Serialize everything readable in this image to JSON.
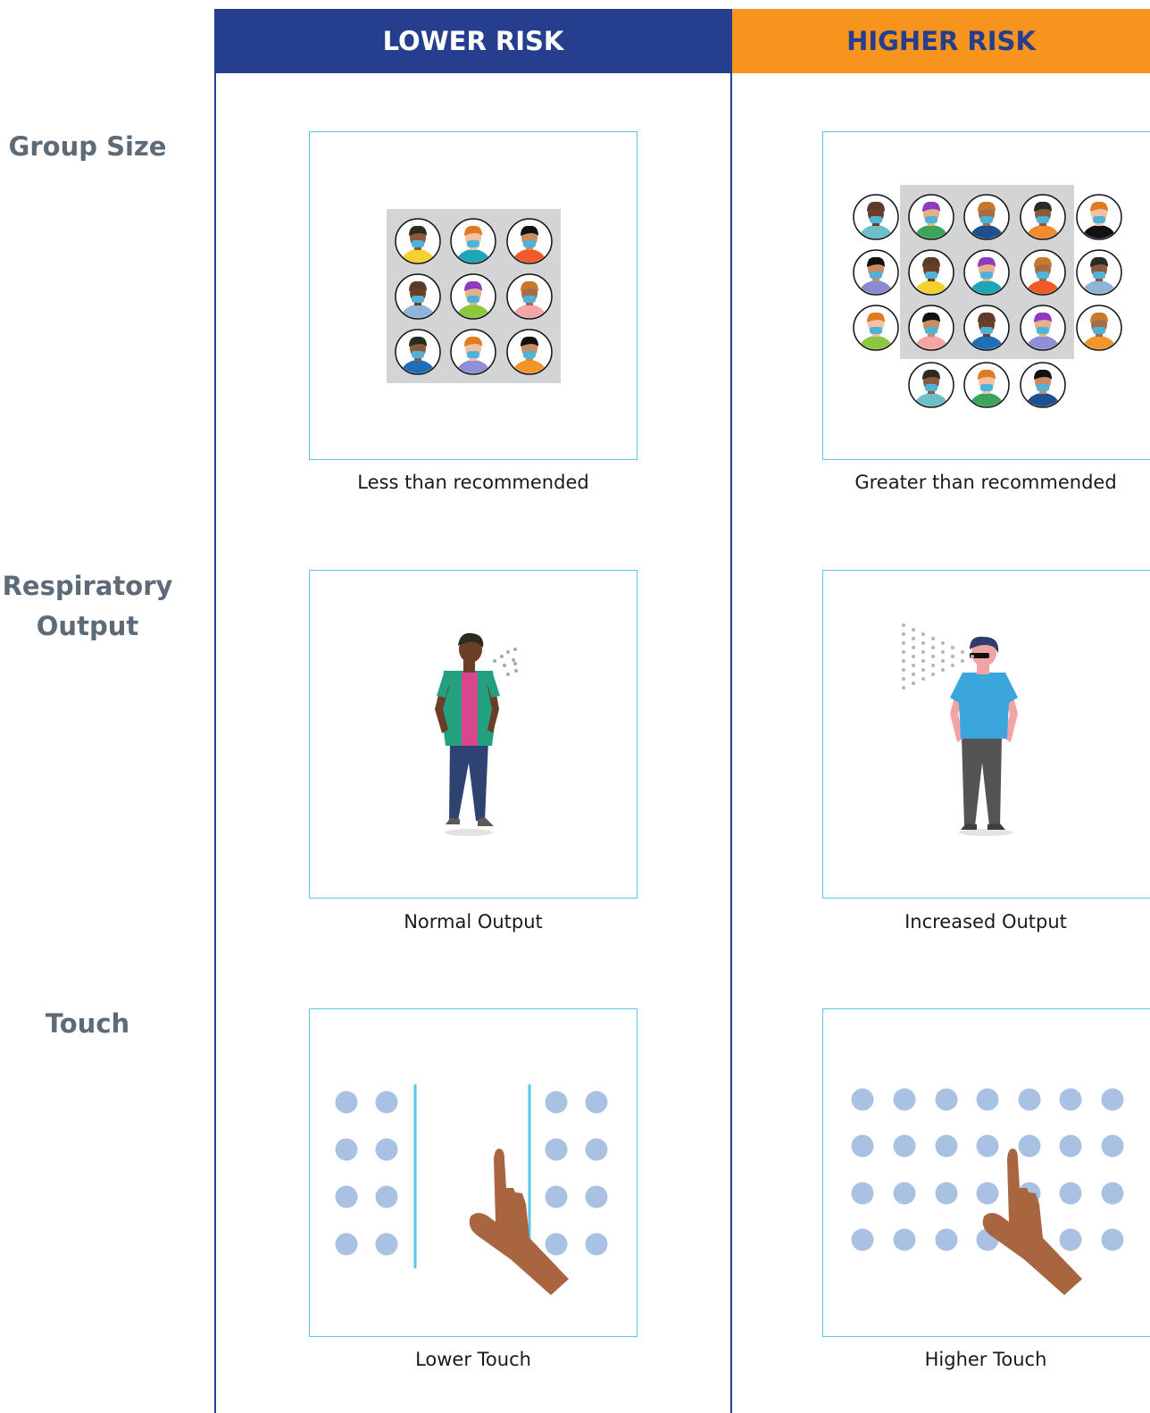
{
  "headers": {
    "lower": "LOWER RISK",
    "higher": "HIGHER RISK"
  },
  "rows": {
    "group_size": {
      "label_line1": "Group Size",
      "label_line2": "",
      "lower_caption": "Less than recommended",
      "higher_caption": "Greater than recommended"
    },
    "respiratory": {
      "label_line1": "Respiratory",
      "label_line2": "Output",
      "lower_caption": "Normal Output",
      "higher_caption": "Increased Output"
    },
    "touch": {
      "label_line1": "Touch",
      "label_line2": "",
      "lower_caption": "Lower Touch",
      "higher_caption": "Higher Touch"
    }
  },
  "colors": {
    "navy": "#253f8e",
    "orange": "#f7941d",
    "tile_border": "#5bc8ea",
    "label_gray": "#5d6b78",
    "dot": "#a9c2e3",
    "skin_hand": "#a8653f"
  },
  "icons": [
    "masked-people-group-icon",
    "standing-person-icon",
    "pointing-hand-icon",
    "touch-surface-dots-icon"
  ]
}
